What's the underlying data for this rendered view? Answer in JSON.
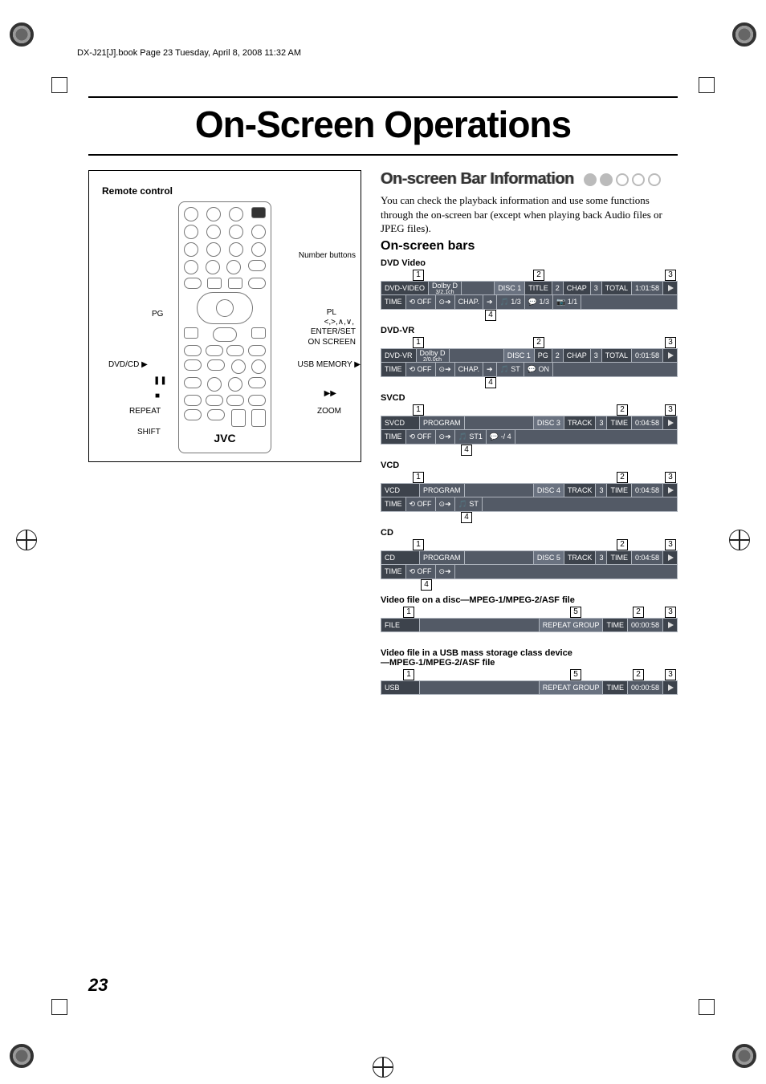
{
  "header_line": "DX-J21[J].book  Page 23  Tuesday, April 8, 2008  11:32 AM",
  "page_title": "On-Screen Operations",
  "page_number": "23",
  "remote": {
    "box_title": "Remote control",
    "brand": "JVC",
    "labels": {
      "number_buttons": "Number\nbuttons",
      "pg": "PG",
      "pl": "PL",
      "nav": "<,>,∧,∨,",
      "enter_set": "ENTER/SET",
      "on_screen": "ON SCREEN",
      "dvd_cd": "DVD/CD ▶",
      "usb_memory": "USB MEMORY ▶",
      "pause": "❚❚",
      "stop": "■",
      "ffwd": "▶▶",
      "repeat": "REPEAT",
      "zoom": "ZOOM",
      "shift": "SHIFT"
    }
  },
  "section": {
    "title": "On-screen Bar Information",
    "intro": "You can check the playback information and use some functions through the on-screen bar (except when playing back Audio files or JPEG files).",
    "subhead": "On-screen bars"
  },
  "callouts": {
    "n1": "1",
    "n2": "2",
    "n3": "3",
    "n4": "4",
    "n5": "5"
  },
  "bars": {
    "dvd_video": {
      "label": "DVD Video",
      "row1": {
        "type": "DVD-VIDEO",
        "audio": "Dolby D",
        "ch": "3/2.1ch",
        "disc": "DISC 1",
        "title_lbl": "TITLE",
        "title_n": "2",
        "chap_lbl": "CHAP",
        "chap_n": "3",
        "total_lbl": "TOTAL",
        "time": "1:01:58"
      },
      "row2": {
        "time_lbl": "TIME",
        "repeat": "⟲ OFF",
        "goto": "⊙➔",
        "chap": "CHAP.",
        "arrow": "➔",
        "aud": "🎵 1/3",
        "sub": "💬 1/3",
        "angle": "📷 1/1"
      }
    },
    "dvd_vr": {
      "label": "DVD-VR",
      "row1": {
        "type": "DVD-VR",
        "audio": "Dolby D",
        "ch": "2/0.0ch",
        "disc": "DISC 1",
        "pg_lbl": "PG",
        "pg_n": "2",
        "chap_lbl": "CHAP",
        "chap_n": "3",
        "total_lbl": "TOTAL",
        "time": "0:01:58"
      },
      "row2": {
        "time_lbl": "TIME",
        "repeat": "⟲ OFF",
        "goto": "⊙➔",
        "chap": "CHAP.",
        "arrow": "➔",
        "aud": "🎵 ST",
        "sub": "💬 ON"
      }
    },
    "svcd": {
      "label": "SVCD",
      "row1": {
        "type": "SVCD",
        "prog": "PROGRAM",
        "disc": "DISC 3",
        "track_lbl": "TRACK",
        "track_n": "3",
        "time_lbl": "TIME",
        "time": "0:04:58"
      },
      "row2": {
        "time_lbl": "TIME",
        "repeat": "⟲ OFF",
        "goto": "⊙➔",
        "aud": "🎵 ST1",
        "sub": "💬 -/ 4"
      }
    },
    "vcd": {
      "label": "VCD",
      "row1": {
        "type": "VCD",
        "prog": "PROGRAM",
        "disc": "DISC 4",
        "track_lbl": "TRACK",
        "track_n": "3",
        "time_lbl": "TIME",
        "time": "0:04:58"
      },
      "row2": {
        "time_lbl": "TIME",
        "repeat": "⟲ OFF",
        "goto": "⊙➔",
        "aud": "🎵 ST"
      }
    },
    "cd": {
      "label": "CD",
      "row1": {
        "type": "CD",
        "prog": "PROGRAM",
        "disc": "DISC 5",
        "track_lbl": "TRACK",
        "track_n": "3",
        "time_lbl": "TIME",
        "time": "0:04:58"
      },
      "row2": {
        "time_lbl": "TIME",
        "repeat": "⟲ OFF",
        "goto": "⊙➔"
      }
    },
    "file_disc": {
      "label": "Video file on a disc—MPEG-1/MPEG-2/ASF file",
      "row1": {
        "type": "FILE",
        "repeat": "REPEAT GROUP",
        "time_lbl": "TIME",
        "time": "00:00:58"
      }
    },
    "file_usb": {
      "label": "Video file in a USB mass storage class device\n—MPEG-1/MPEG-2/ASF file",
      "row1": {
        "type": "USB",
        "repeat": "REPEAT GROUP",
        "time_lbl": "TIME",
        "time": "00:00:58"
      }
    }
  }
}
